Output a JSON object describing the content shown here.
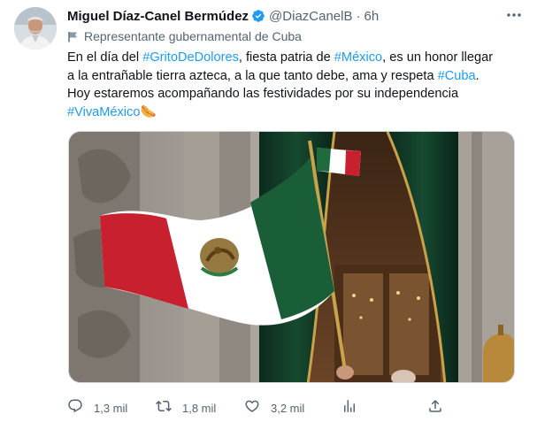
{
  "tweet": {
    "author_name": "Miguel Díaz-Canel Bermúdez",
    "handle": "@DiazCanelB",
    "separator": "·",
    "time": "6h",
    "label": "Representante gubernamental de Cuba",
    "text_lines": [
      [
        {
          "t": "En el día del ",
          "h": false
        },
        {
          "t": "#GritoDeDolores",
          "h": true
        },
        {
          "t": ", fiesta patria de ",
          "h": false
        },
        {
          "t": "#México",
          "h": true
        },
        {
          "t": ", es un honor llegar",
          "h": false
        }
      ],
      [
        {
          "t": "a la entrañable tierra azteca, a la que tanto debe, ama y respeta ",
          "h": false
        },
        {
          "t": "#Cuba",
          "h": true
        },
        {
          "t": ".",
          "h": false
        }
      ],
      [
        {
          "t": "Hoy estaremos acompañando las festividades por su independencia",
          "h": false
        }
      ],
      [
        {
          "t": "#VivaMéxico",
          "h": true
        },
        {
          "t": "🌭",
          "h": false,
          "emoji": true
        }
      ]
    ],
    "media_description_icon": "photo",
    "colors": {
      "text": "#0f1419",
      "secondary": "#536471",
      "link": "#1d9bf0",
      "verified": "#1d9bf0"
    }
  },
  "actions": {
    "reply_count": "1,3 mil",
    "retweet_count": "1,8 mil",
    "like_count": "3,2 mil",
    "icons": [
      "reply-icon",
      "retweet-icon",
      "like-icon",
      "views-icon",
      "share-icon"
    ]
  }
}
